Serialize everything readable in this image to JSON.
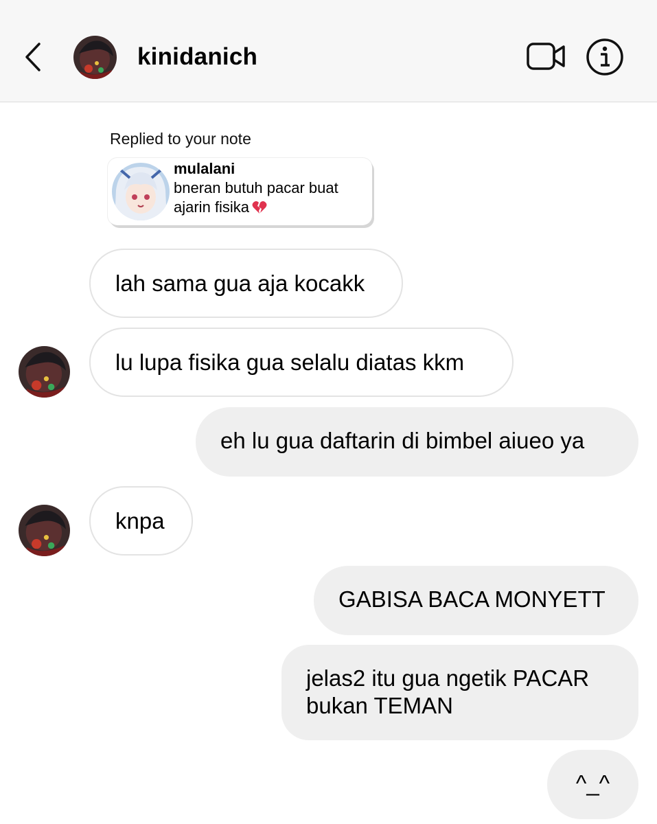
{
  "header": {
    "username": "kinidanich",
    "icons": {
      "back": "chevron-left-icon",
      "video": "video-camera-icon",
      "info": "info-icon"
    }
  },
  "note_reply": {
    "label": "Replied to your note",
    "note_user": "mulalani",
    "note_text": "bneran butuh pacar buat ajarin fisika",
    "note_emoji": "broken-heart-icon"
  },
  "messages": [
    {
      "from": "them",
      "text": "lah sama gua aja kocakk"
    },
    {
      "from": "them",
      "text": "lu lupa fisika gua selalu diatas kkm"
    },
    {
      "from": "me",
      "text": "eh lu gua daftarin di bimbel aiueo ya"
    },
    {
      "from": "them",
      "text": "knpa"
    },
    {
      "from": "me",
      "text": "GABISA BACA MONYETT"
    },
    {
      "from": "me",
      "text": "jelas2 itu gua ngetik PACAR bukan TEMAN"
    },
    {
      "from": "me",
      "text": "^_^"
    }
  ],
  "colors": {
    "incoming_border": "#e3e3e3",
    "outgoing_bg": "#efefef",
    "header_bg": "#f7f7f7",
    "heart": "#e0334f"
  }
}
